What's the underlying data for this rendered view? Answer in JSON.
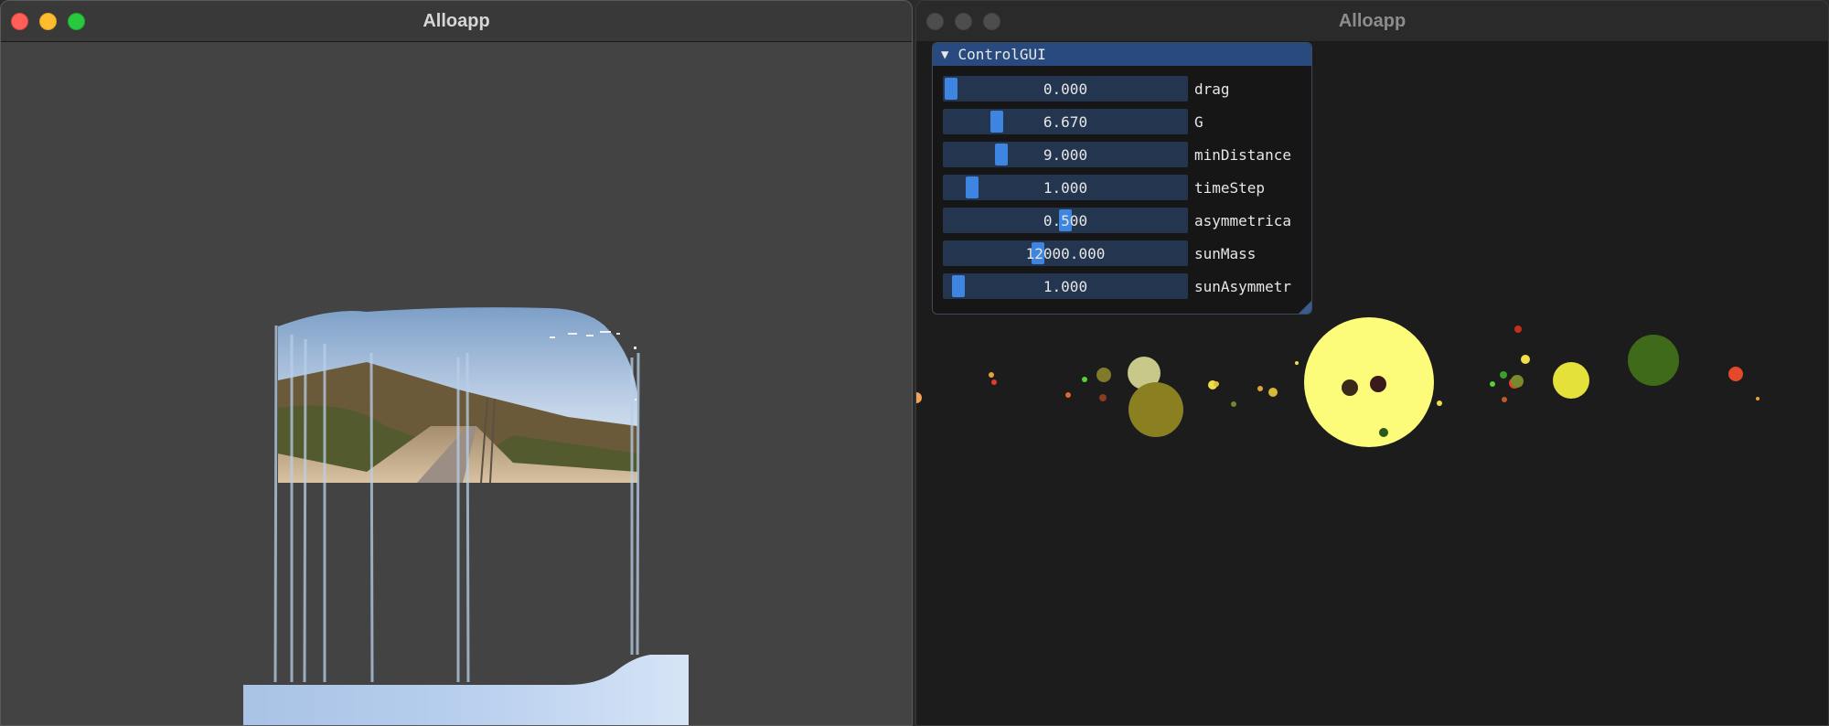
{
  "windows": {
    "left": {
      "title": "Alloapp"
    },
    "right": {
      "title": "Alloapp"
    }
  },
  "control_gui": {
    "header": "ControlGUI",
    "collapse_icon": "triangle-down-icon",
    "sliders": [
      {
        "label": "drag",
        "value": "0.000",
        "fraction": 0.0
      },
      {
        "label": "G",
        "value": "6.670",
        "fraction": 0.2
      },
      {
        "label": "minDistance",
        "value": "9.000",
        "fraction": 0.22
      },
      {
        "label": "timeStep",
        "value": "1.000",
        "fraction": 0.09
      },
      {
        "label": "asymmetrica",
        "value": "0.500",
        "fraction": 0.5
      },
      {
        "label": "sunMass",
        "value": "12000.000",
        "fraction": 0.38
      },
      {
        "label": "sunAsymmetr",
        "value": "1.000",
        "fraction": 0.03
      }
    ]
  },
  "colors": {
    "accent": "#3d85e0",
    "slider_frame": "#24364f",
    "header": "#284a7e",
    "sun": "#fdfb7a",
    "left_background": "#434343",
    "right_background": "#1c1c1c"
  }
}
